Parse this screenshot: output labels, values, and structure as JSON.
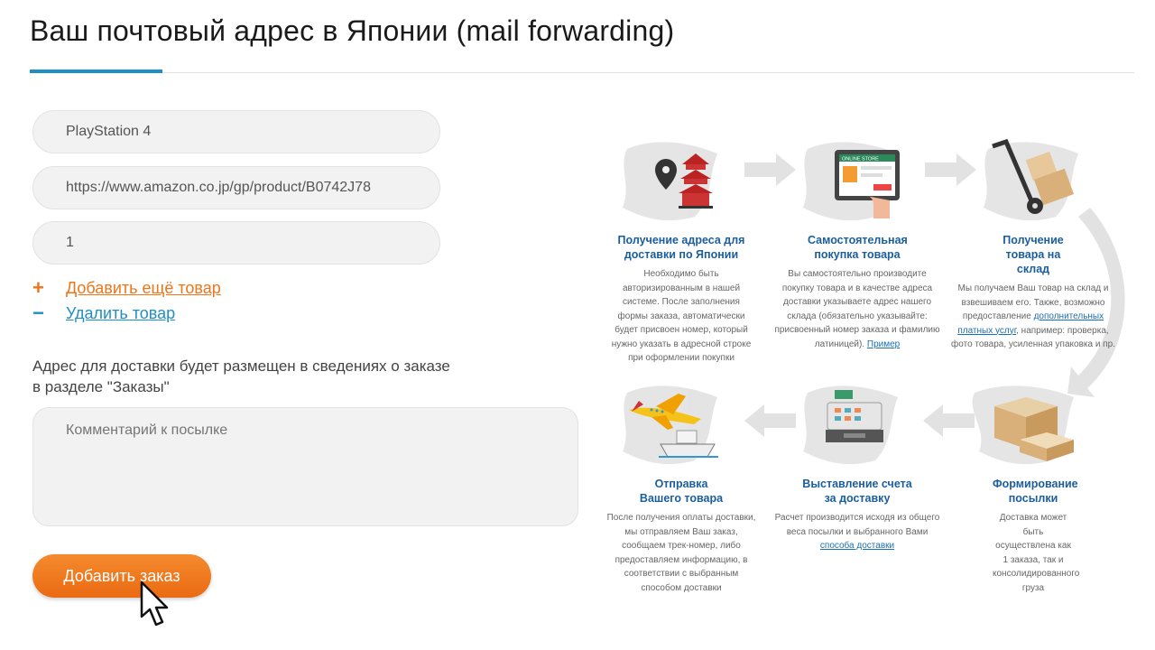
{
  "page": {
    "title": "Ваш почтовый адрес в Японии (mail forwarding)"
  },
  "form": {
    "item_name": "PlayStation 4",
    "item_url": "https://www.amazon.co.jp/gp/product/B0742J78",
    "quantity": "1",
    "add_item": "Добавить ещё товар",
    "remove_item": "Удалить товар",
    "note": "Адрес для доставки будет размещен в сведениях о заказе в разделе \"Заказы\"",
    "comment_placeholder": "Комментарий к посылке",
    "submit": "Добавить заказ"
  },
  "colors": {
    "accent": "#ee7518",
    "link": "#1e8fc6",
    "title": "#1a5e9e"
  },
  "steps": [
    {
      "title": "Получение адреса для доставки по Японии",
      "text": "Необходимо быть авторизированным в нашей системе.  После заполнения формы заказа, автоматически будет присвоен номер, который нужно указать в адресной строке при оформлении покупки",
      "icon": "pagoda-location-icon"
    },
    {
      "title": "Самостоятельная покупка товара",
      "text": "Вы самостоятельно производите покупку товара и в качестве адреса доставки указываете адрес нашего склада (обязательно указывайте: присвоенный номер заказа и фамилию латиницей).",
      "link": "Пример",
      "icon": "tablet-online-store-icon",
      "store_label": "ONLINE STORE"
    },
    {
      "title": "Получение товара на склад",
      "text_before": "Мы получаем Ваш товар на склад и взвешиваем его. Также, возможно предоставление",
      "link": "дополнительных платных услуг",
      "text_after": ", например: проверка, фото товара, усиленная упаковка  и пр.",
      "icon": "hand-truck-icon"
    },
    {
      "title": "Формирование посылки",
      "text": "Доставка может быть осуществлена как 1 заказа, так и консолидированного груза",
      "icon": "boxes-icon"
    },
    {
      "title": "Выставление счета за доставку",
      "text": "Расчет производится исходя из общего веса посылки и выбранного Вами",
      "link": "способа доставки",
      "icon": "cash-register-icon"
    },
    {
      "title": "Отправка Вашего товара",
      "text": "После получения оплаты доставки, мы отправляем Ваш заказ, сообщаем трек-номер, либо предоставляем информацию, в соответствии с выбранным способом доставки",
      "icon": "plane-ship-icon"
    }
  ]
}
